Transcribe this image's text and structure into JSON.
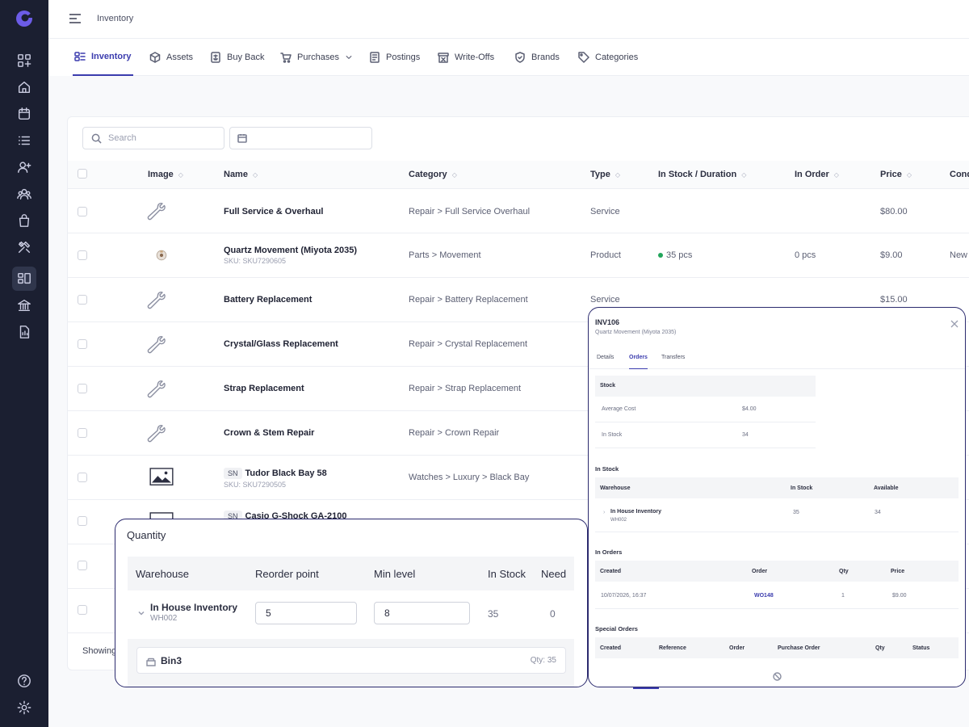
{
  "topbar": {
    "title": "Inventory"
  },
  "tabs": [
    {
      "label": "Inventory",
      "icon": "inventory-icon",
      "active": true
    },
    {
      "label": "Assets",
      "icon": "cube-icon"
    },
    {
      "label": "Buy Back",
      "icon": "buyback-icon"
    },
    {
      "label": "Purchases",
      "icon": "cart-icon",
      "dropdown": true
    },
    {
      "label": "Postings",
      "icon": "document-icon"
    },
    {
      "label": "Write-Offs",
      "icon": "writeoff-icon"
    },
    {
      "label": "Brands",
      "icon": "shield-icon"
    },
    {
      "label": "Categories",
      "icon": "tag-icon"
    }
  ],
  "toolbar": {
    "search_placeholder": "Search"
  },
  "table": {
    "columns": [
      "Image",
      "Name",
      "Category",
      "Type",
      "In Stock / Duration",
      "In Order",
      "Price",
      "Cond"
    ],
    "rows": [
      {
        "name": "Full Service & Overhaul",
        "sku": "",
        "category": "Repair > Full Service Overhaul",
        "type": "Service",
        "stock": "",
        "order": "",
        "price": "$80.00",
        "cond": "",
        "image": "wrench-icon"
      },
      {
        "name": "Quartz Movement (Miyota 2035)",
        "sku": "SKU: SKU7290605",
        "category": "Parts > Movement",
        "type": "Product",
        "stock": "35 pcs",
        "order": "0 pcs",
        "price": "$9.00",
        "cond": "New",
        "image": "movement-photo"
      },
      {
        "name": "Battery Replacement",
        "sku": "",
        "category": "Repair > Battery Replacement",
        "type": "Service",
        "stock": "",
        "order": "",
        "price": "$15.00",
        "cond": "",
        "image": "wrench-icon"
      },
      {
        "name": "Crystal/Glass Replacement",
        "sku": "",
        "category": "Repair > Crystal Replacement",
        "type": "",
        "stock": "",
        "order": "",
        "price": "",
        "cond": "",
        "image": "wrench-icon"
      },
      {
        "name": "Strap Replacement",
        "sku": "",
        "category": "Repair > Strap Replacement",
        "type": "",
        "stock": "",
        "order": "",
        "price": "",
        "cond": "",
        "image": "wrench-icon"
      },
      {
        "name": "Crown & Stem Repair",
        "sku": "",
        "category": "Repair > Crown Repair",
        "type": "",
        "stock": "",
        "order": "",
        "price": "",
        "cond": "",
        "image": "wrench-icon"
      },
      {
        "name": "Tudor Black Bay 58",
        "badge": "SN",
        "sku": "SKU: SKU7290505",
        "category": "Watches > Luxury > Black Bay",
        "type": "",
        "stock": "",
        "order": "",
        "price": "",
        "cond": "",
        "image": "image-placeholder-icon"
      },
      {
        "name": "Casio G-Shock GA-2100",
        "badge": "SN",
        "sku": "",
        "category": "",
        "type": "",
        "stock": "",
        "order": "",
        "price": "",
        "cond": "",
        "image": "image-placeholder-icon"
      }
    ],
    "footer_text": "Showing"
  },
  "quantity_popup": {
    "title": "Quantity",
    "columns": [
      "Warehouse",
      "Reorder point",
      "Min level",
      "In Stock",
      "Need"
    ],
    "row": {
      "warehouse": "In House Inventory",
      "code": "WH002",
      "reorder_point": "5",
      "min_level": "8",
      "in_stock": "35",
      "need": "0"
    },
    "bin": {
      "label": "Bin3",
      "qty": "Qty: 35"
    }
  },
  "detail_popup": {
    "id": "INV106",
    "subtitle": "Quartz Movement (Miyota 2035)",
    "tabs": [
      "Details",
      "Orders",
      "Transfers"
    ],
    "active_tab": "Orders",
    "stock": {
      "title": "Stock",
      "average_cost_label": "Average Cost",
      "average_cost": "$4.00",
      "in_stock_label": "In Stock",
      "in_stock": "34"
    },
    "in_stock_section": {
      "title": "In Stock",
      "columns": [
        "Warehouse",
        "In Stock",
        "Available"
      ],
      "row": {
        "warehouse": "In House Inventory",
        "code": "WH002",
        "in_stock": "35",
        "available": "34"
      }
    },
    "in_orders_section": {
      "title": "In Orders",
      "columns": [
        "Created",
        "Order",
        "Qty",
        "Price"
      ],
      "row": {
        "created": "10/07/2026, 16:37",
        "order": "WO148",
        "qty": "1",
        "price": "$9.00"
      }
    },
    "special_orders_section": {
      "title": "Special Orders",
      "columns": [
        "Created",
        "Reference",
        "Order",
        "Purchase Order",
        "Qty",
        "Status"
      ]
    }
  },
  "colors": {
    "accent": "#3b3cae",
    "sidebar": "#1b1f31",
    "in_stock_dot": "#22a55b"
  }
}
